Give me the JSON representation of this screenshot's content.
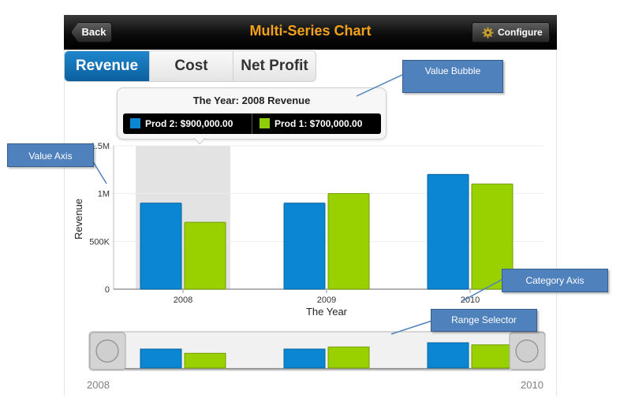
{
  "header": {
    "back_label": "Back",
    "title": "Multi-Series Chart",
    "configure_label": "Configure"
  },
  "tabs": [
    {
      "label": "Revenue",
      "active": true
    },
    {
      "label": "Cost",
      "active": false
    },
    {
      "label": "Net Profit",
      "active": false
    }
  ],
  "bubble": {
    "title": "The Year: 2008  Revenue",
    "items": [
      {
        "label": "Prod 2: $900,000.00",
        "color": "#0a86d2"
      },
      {
        "label": "Prod 1: $700,000.00",
        "color": "#8ccc08"
      }
    ]
  },
  "chart_data": {
    "type": "bar",
    "categories": [
      "2008",
      "2009",
      "2010"
    ],
    "series": [
      {
        "name": "Prod 2",
        "color": "#0a86d2",
        "values": [
          900000,
          900000,
          1200000
        ]
      },
      {
        "name": "Prod 1",
        "color": "#99d100",
        "values": [
          700000,
          1000000,
          1100000
        ]
      }
    ],
    "xlabel": "The Year",
    "ylabel": "Revenue",
    "ylim": [
      0,
      1500000
    ],
    "y_ticks": [
      {
        "value": 0,
        "label": "0"
      },
      {
        "value": 500000,
        "label": "500K"
      },
      {
        "value": 1000000,
        "label": "1M"
      },
      {
        "value": 1500000,
        "label": "1.5M"
      }
    ],
    "selected_category": "2008",
    "grid": true
  },
  "range_selector": {
    "start_label": "2008",
    "end_label": "2010"
  },
  "callouts": {
    "value_bubble": "Value Bubble",
    "value_axis": "Value Axis",
    "category_axis": "Category Axis",
    "range_selector": "Range Selector"
  },
  "icons": {
    "configure": "gear-icon",
    "range_handles": "circle-handle-icon"
  },
  "colors": {
    "title": "#f4a11a",
    "active_tab": "#0b6db4",
    "callout": "#4f81bd"
  }
}
